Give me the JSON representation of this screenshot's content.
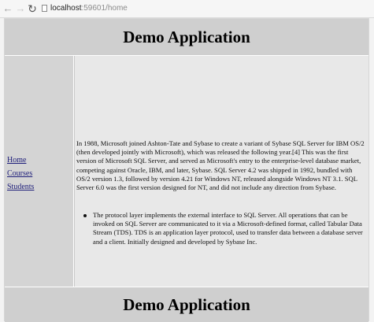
{
  "browser": {
    "back_icon": "back-arrow-icon",
    "forward_icon": "forward-arrow-icon",
    "reload_icon": "reload-icon",
    "page_icon": "page-icon",
    "url_host": "localhost",
    "url_path": ":59601/home"
  },
  "header": {
    "title": "Demo Application"
  },
  "sidebar": {
    "items": [
      {
        "label": "Home"
      },
      {
        "label": "Courses"
      },
      {
        "label": "Students"
      }
    ]
  },
  "main": {
    "paragraph": "In 1988, Microsoft joined Ashton-Tate and Sybase to create a variant of Sybase SQL Server for IBM OS/2 (then developed jointly with Microsoft), which was released the following year.[4] This was the first version of Microsoft SQL Server, and served as Microsoft's entry to the enterprise-level database market, competing against Oracle, IBM, and later, Sybase. SQL Server 4.2 was shipped in 1992, bundled with OS/2 version 1.3, followed by version 4.21 for Windows NT, released alongside Windows NT 3.1. SQL Server 6.0 was the first version designed for NT, and did not include any direction from Sybase.",
    "bullets": [
      "The protocol layer implements the external interface to SQL Server. All operations that can be invoked on SQL Server are communicated to it via a Microsoft-defined format, called Tabular Data Stream (TDS). TDS is an application layer protocol, used to transfer data between a database server and a client. Initially designed and developed by Sybase Inc."
    ]
  },
  "footer": {
    "title": "Demo Application"
  }
}
